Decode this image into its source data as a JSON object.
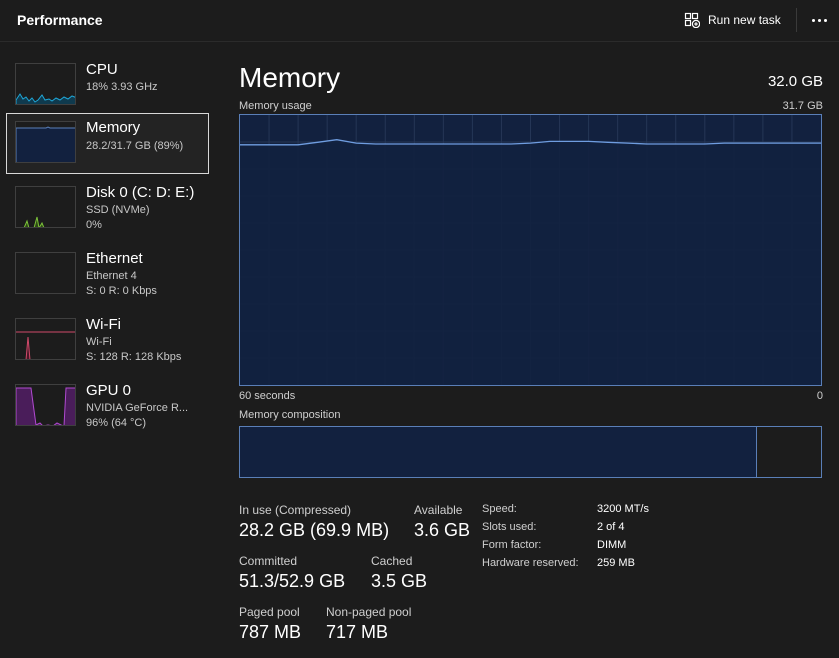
{
  "header": {
    "title": "Performance",
    "run_task_label": "Run new task"
  },
  "sidebar": {
    "items": [
      {
        "name": "CPU",
        "line1": "18% 3.93 GHz",
        "line2": "",
        "color": "#1fa7d8"
      },
      {
        "name": "Memory",
        "line1": "28.2/31.7 GB (89%)",
        "line2": "",
        "color": "#5a7fb8"
      },
      {
        "name": "Disk 0 (C: D: E:)",
        "line1": "SSD (NVMe)",
        "line2": "0%",
        "color": "#7cc23a"
      },
      {
        "name": "Ethernet",
        "line1": "Ethernet 4",
        "line2": "S: 0 R: 0 Kbps",
        "color": "#a0a0a0"
      },
      {
        "name": "Wi-Fi",
        "line1": "Wi-Fi",
        "line2": "S: 128 R: 128 Kbps",
        "color": "#d04a6a"
      },
      {
        "name": "GPU 0",
        "line1": "NVIDIA GeForce R...",
        "line2": "96% (64 °C)",
        "color": "#b04ad0"
      }
    ]
  },
  "main": {
    "title": "Memory",
    "total": "32.0 GB",
    "usage_label": "Memory usage",
    "usage_max": "31.7 GB",
    "time_label": "60 seconds",
    "time_end": "0",
    "composition_label": "Memory composition",
    "composition_in_use_fraction": 0.89
  },
  "stats": {
    "in_use_label": "In use (Compressed)",
    "in_use_value": "28.2 GB (69.9 MB)",
    "available_label": "Available",
    "available_value": "3.6 GB",
    "committed_label": "Committed",
    "committed_value": "51.3/52.9 GB",
    "cached_label": "Cached",
    "cached_value": "3.5 GB",
    "paged_label": "Paged pool",
    "paged_value": "787 MB",
    "nonpaged_label": "Non-paged pool",
    "nonpaged_value": "717 MB"
  },
  "hardware": [
    {
      "label": "Speed:",
      "value": "3200 MT/s"
    },
    {
      "label": "Slots used:",
      "value": "2 of 4"
    },
    {
      "label": "Form factor:",
      "value": "DIMM"
    },
    {
      "label": "Hardware reserved:",
      "value": "259 MB"
    }
  ],
  "chart_data": {
    "type": "area",
    "title": "Memory usage",
    "xlabel": "",
    "ylabel": "",
    "x": [
      60,
      58,
      56,
      54,
      52,
      50,
      48,
      46,
      44,
      42,
      40,
      38,
      36,
      34,
      32,
      30,
      28,
      26,
      24,
      22,
      20,
      18,
      16,
      14,
      12,
      10,
      8,
      6,
      4,
      2,
      0
    ],
    "series": [
      {
        "values": [
          28.2,
          28.2,
          28.2,
          28.2,
          28.5,
          28.8,
          28.4,
          28.3,
          28.3,
          28.3,
          28.3,
          28.3,
          28.3,
          28.3,
          28.3,
          28.4,
          28.6,
          28.6,
          28.6,
          28.5,
          28.4,
          28.3,
          28.3,
          28.3,
          28.3,
          28.4,
          28.4,
          28.4,
          28.4,
          28.4,
          28.4
        ]
      }
    ],
    "xlim": [
      60,
      0
    ],
    "ylim": [
      0,
      31.7
    ],
    "grid": true,
    "colors": {
      "line": "#6f9de0",
      "fill": "#12213f",
      "grid": "#253656"
    }
  }
}
